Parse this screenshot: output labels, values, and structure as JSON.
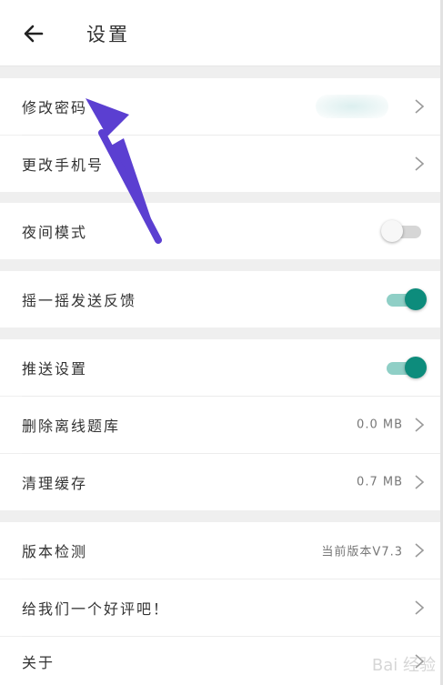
{
  "header": {
    "title": "设置",
    "back_icon": "arrow-left-icon"
  },
  "groups": [
    {
      "items": [
        {
          "label": "修改密码",
          "value": "",
          "control": "chevron"
        },
        {
          "label": "更改手机号",
          "value": "",
          "control": "chevron"
        }
      ]
    },
    {
      "items": [
        {
          "label": "夜间模式",
          "control": "toggle",
          "on": false
        }
      ]
    },
    {
      "items": [
        {
          "label": "摇一摇发送反馈",
          "control": "toggle",
          "on": true
        }
      ]
    },
    {
      "items": [
        {
          "label": "推送设置",
          "control": "toggle",
          "on": true
        },
        {
          "label": "删除离线题库",
          "value": "0.0 MB",
          "control": "chevron"
        },
        {
          "label": "清理缓存",
          "value": "0.7 MB",
          "control": "chevron"
        }
      ]
    },
    {
      "items": [
        {
          "label": "版本检测",
          "value": "当前版本V7.3",
          "control": "chevron"
        },
        {
          "label": "给我们一个好评吧！",
          "value": "",
          "control": "chevron"
        },
        {
          "label": "关于",
          "value": "",
          "control": "chevron"
        }
      ]
    }
  ],
  "colors": {
    "accent": "#0d8c7c",
    "annotation_arrow": "#5b3fd1"
  },
  "watermark": "Bai 经验"
}
